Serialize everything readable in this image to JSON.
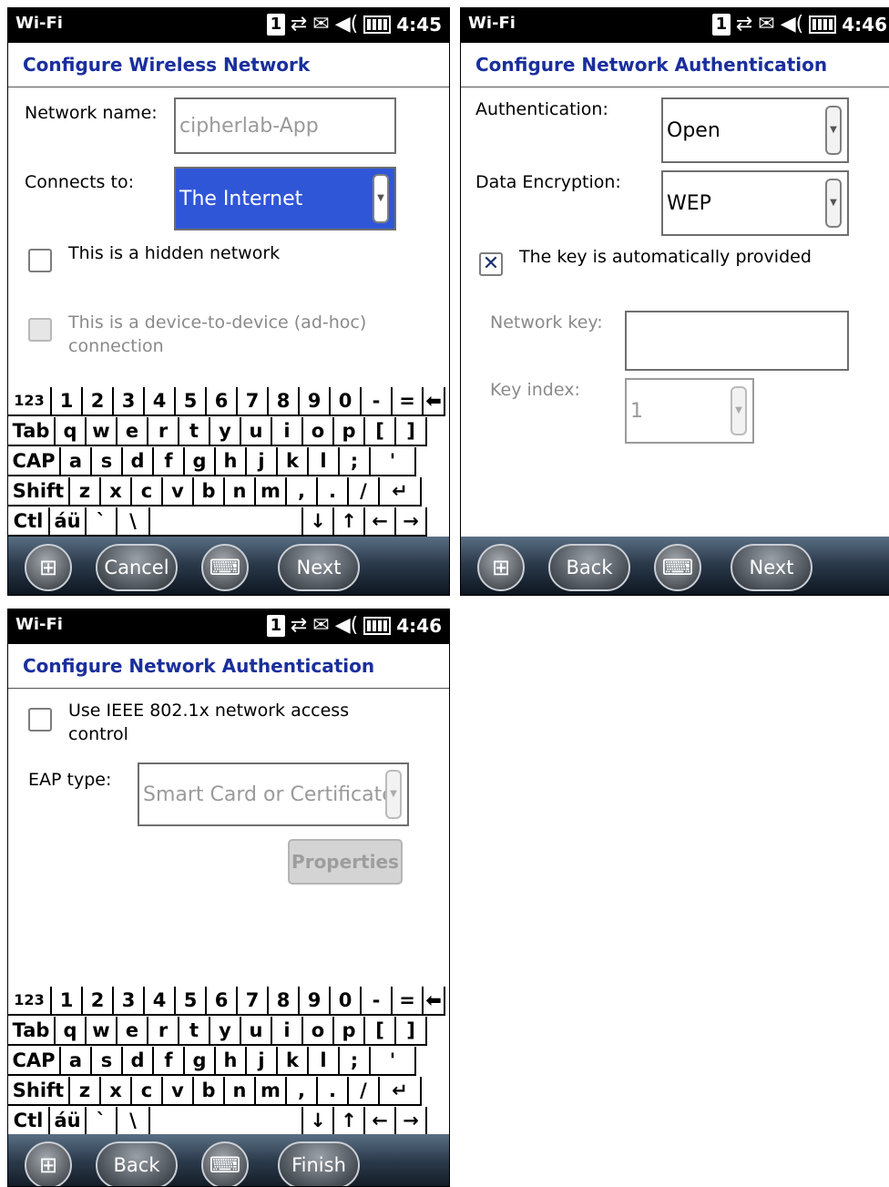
{
  "status": {
    "app": "Wi-Fi",
    "sim": "1",
    "sync": "⇄",
    "msg": "✉",
    "vol": "◀(",
    "time1": "4:45",
    "time2": "4:46",
    "time3": "4:46"
  },
  "screen1": {
    "title": "Configure Wireless Network",
    "network_name_label": "Network name:",
    "network_name_value": "cipherlab-App",
    "connects_label": "Connects to:",
    "connects_value": "The Internet",
    "hidden_label": "This is a hidden network",
    "adhoc_label_1": "This is a device-to-device (ad-hoc)",
    "adhoc_label_2": "connection",
    "left_button": "Cancel",
    "right_button": "Next"
  },
  "screen2": {
    "title": "Configure Network Authentication",
    "auth_label": "Authentication:",
    "auth_value": "Open",
    "enc_label": "Data Encryption:",
    "enc_value": "WEP",
    "auto_key_label": "The key is automatically provided",
    "auto_key_checked": "✕",
    "key_label": "Network key:",
    "key_value": "",
    "index_label": "Key index:",
    "index_value": "1",
    "left_button": "Back",
    "right_button": "Next"
  },
  "screen3": {
    "title": "Configure Network Authentication",
    "ieee_label_1": "Use IEEE 802.1x network access",
    "ieee_label_2": "control",
    "eap_label": "EAP type:",
    "eap_value": "Smart Card or Certificate",
    "properties_button": "Properties",
    "left_button": "Back",
    "right_button": "Finish"
  },
  "keyboard": {
    "row1": [
      "123",
      "1",
      "2",
      "3",
      "4",
      "5",
      "6",
      "7",
      "8",
      "9",
      "0",
      "-",
      "=",
      "⬅"
    ],
    "row2": [
      "Tab",
      "q",
      "w",
      "e",
      "r",
      "t",
      "y",
      "u",
      "i",
      "o",
      "p",
      "[",
      "]"
    ],
    "row3": [
      "CAP",
      "a",
      "s",
      "d",
      "f",
      "g",
      "h",
      "j",
      "k",
      "l",
      ";",
      "'"
    ],
    "row4": [
      "Shift",
      "z",
      "x",
      "c",
      "v",
      "b",
      "n",
      "m",
      ",",
      ".",
      "/",
      "↵"
    ],
    "row5": [
      "Ctl",
      "áü",
      "`",
      "\\",
      "",
      "↓",
      "↑",
      "←",
      "→"
    ]
  },
  "icons": {
    "start": "windows-start-icon",
    "keyboard": "keyboard-icon",
    "dropdown": "dropdown-arrow-icon"
  }
}
